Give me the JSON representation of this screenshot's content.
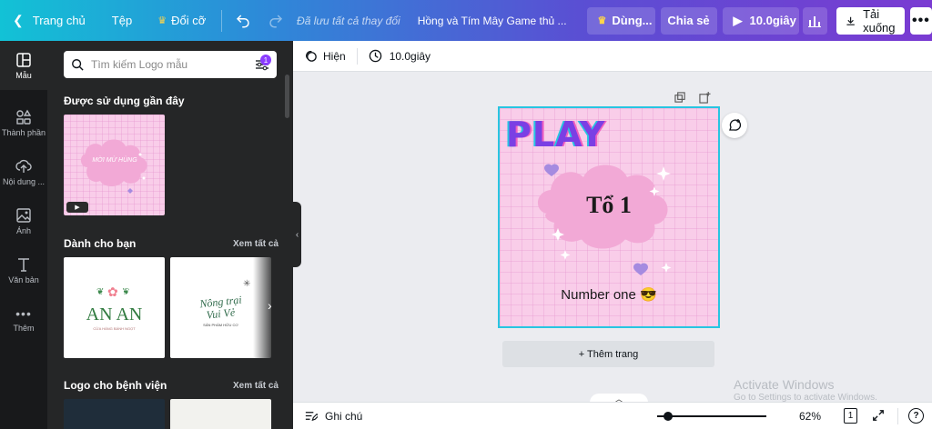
{
  "topbar": {
    "home": "Trang chủ",
    "file": "Tệp",
    "resize": "Đổi cỡ",
    "save_status": "Đã lưu tất cả thay đổi",
    "doc_title": "Hồng và Tím Mây Game thủ ...",
    "crown_btn": "Dùng...",
    "share": "Chia sẻ",
    "play": "10.0giây",
    "download": "Tải xuống"
  },
  "rail": [
    {
      "label": "Mẫu",
      "icon": "template-icon"
    },
    {
      "label": "Thành phần",
      "icon": "elements-icon"
    },
    {
      "label": "Nội dung ...",
      "icon": "upload-icon"
    },
    {
      "label": "Ảnh",
      "icon": "photo-icon"
    },
    {
      "label": "Văn bản",
      "icon": "text-icon"
    },
    {
      "label": "Thêm",
      "icon": "more-icon"
    }
  ],
  "panel": {
    "search_placeholder": "Tìm kiếm Logo mẫu",
    "filter_count": "1",
    "recent_title": "Được sử dụng gần đây",
    "recent_thumb_text": "MỜI MỪ HÙNG",
    "for_you_title": "Dành cho bạn",
    "see_all_1": "Xem tất cả",
    "card1_title": "AN AN",
    "card1_sub": "CỬA HÀNG BÁNH NGỌT",
    "card2_title1": "Nông trại",
    "card2_title2": "Vui Vẻ",
    "card2_sub": "SẢN PHẨM HỮU CƠ",
    "hospital_title": "Logo cho bệnh viện",
    "see_all_2": "Xem tất cả"
  },
  "subbar": {
    "hide": "Hiện",
    "duration": "10.0giây"
  },
  "design": {
    "heading": "PLAY",
    "cloud_text": "Tổ 1",
    "caption": "Number one 😎"
  },
  "add_page": "+ Thêm trang",
  "watermark": {
    "line1": "Activate Windows",
    "line2": "Go to Settings to activate Windows."
  },
  "bottombar": {
    "notes": "Ghi chú",
    "zoom": "62%",
    "page_num": "1",
    "zoom_level": 0.1
  },
  "colors": {
    "accent_cyan": "#27c5e1",
    "purple": "#8b3dff",
    "pink_bg": "#f9cde9"
  }
}
